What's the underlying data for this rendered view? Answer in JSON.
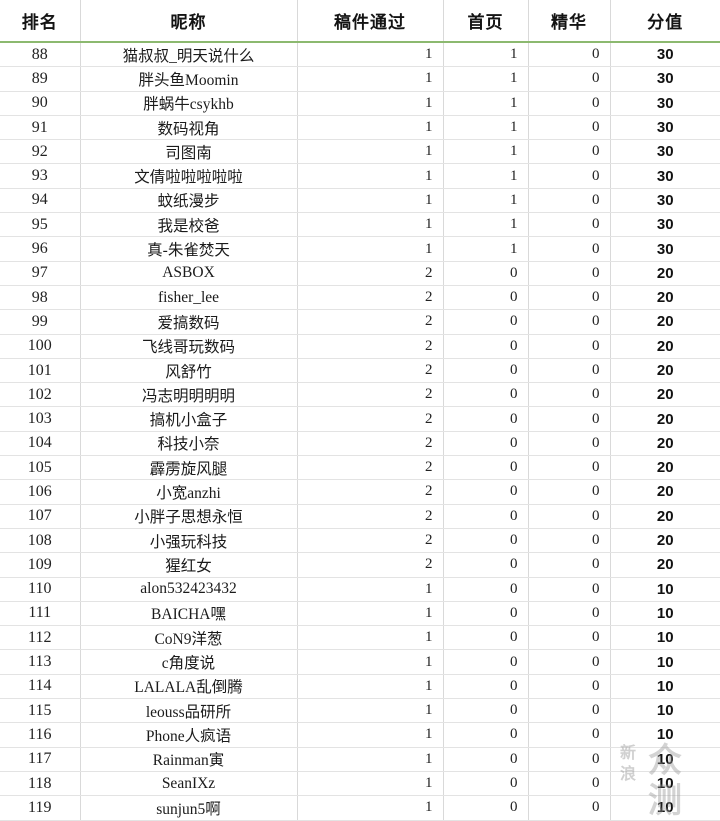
{
  "table": {
    "columns": [
      {
        "key": "rank",
        "label": "排名",
        "align": "center"
      },
      {
        "key": "nick",
        "label": "昵称",
        "align": "center"
      },
      {
        "key": "pass",
        "label": "稿件通过",
        "align": "right"
      },
      {
        "key": "home",
        "label": "首页",
        "align": "right"
      },
      {
        "key": "elite",
        "label": "精华",
        "align": "right"
      },
      {
        "key": "score",
        "label": "分值",
        "align": "center"
      }
    ],
    "rows": [
      {
        "rank": "88",
        "nick": "猫叔叔_明天说什么",
        "pass": "1",
        "home": "1",
        "elite": "0",
        "score": "30"
      },
      {
        "rank": "89",
        "nick": "胖头鱼Moomin",
        "pass": "1",
        "home": "1",
        "elite": "0",
        "score": "30"
      },
      {
        "rank": "90",
        "nick": "胖蜗牛csykhb",
        "pass": "1",
        "home": "1",
        "elite": "0",
        "score": "30"
      },
      {
        "rank": "91",
        "nick": "数码视角",
        "pass": "1",
        "home": "1",
        "elite": "0",
        "score": "30"
      },
      {
        "rank": "92",
        "nick": "司图南",
        "pass": "1",
        "home": "1",
        "elite": "0",
        "score": "30"
      },
      {
        "rank": "93",
        "nick": "文倩啦啦啦啦啦",
        "pass": "1",
        "home": "1",
        "elite": "0",
        "score": "30"
      },
      {
        "rank": "94",
        "nick": "蚊纸漫步",
        "pass": "1",
        "home": "1",
        "elite": "0",
        "score": "30"
      },
      {
        "rank": "95",
        "nick": "我是校爸",
        "pass": "1",
        "home": "1",
        "elite": "0",
        "score": "30"
      },
      {
        "rank": "96",
        "nick": "真-朱雀焚天",
        "pass": "1",
        "home": "1",
        "elite": "0",
        "score": "30"
      },
      {
        "rank": "97",
        "nick": "ASBOX",
        "pass": "2",
        "home": "0",
        "elite": "0",
        "score": "20"
      },
      {
        "rank": "98",
        "nick": "fisher_lee",
        "pass": "2",
        "home": "0",
        "elite": "0",
        "score": "20"
      },
      {
        "rank": "99",
        "nick": "爱搞数码",
        "pass": "2",
        "home": "0",
        "elite": "0",
        "score": "20"
      },
      {
        "rank": "100",
        "nick": "飞线哥玩数码",
        "pass": "2",
        "home": "0",
        "elite": "0",
        "score": "20"
      },
      {
        "rank": "101",
        "nick": "风舒竹",
        "pass": "2",
        "home": "0",
        "elite": "0",
        "score": "20"
      },
      {
        "rank": "102",
        "nick": "冯志明明明明",
        "pass": "2",
        "home": "0",
        "elite": "0",
        "score": "20"
      },
      {
        "rank": "103",
        "nick": "搞机小盒子",
        "pass": "2",
        "home": "0",
        "elite": "0",
        "score": "20"
      },
      {
        "rank": "104",
        "nick": "科技小奈",
        "pass": "2",
        "home": "0",
        "elite": "0",
        "score": "20"
      },
      {
        "rank": "105",
        "nick": "霹雳旋风腿",
        "pass": "2",
        "home": "0",
        "elite": "0",
        "score": "20"
      },
      {
        "rank": "106",
        "nick": "小宽anzhi",
        "pass": "2",
        "home": "0",
        "elite": "0",
        "score": "20"
      },
      {
        "rank": "107",
        "nick": "小胖子思想永恒",
        "pass": "2",
        "home": "0",
        "elite": "0",
        "score": "20"
      },
      {
        "rank": "108",
        "nick": "小强玩科技",
        "pass": "2",
        "home": "0",
        "elite": "0",
        "score": "20"
      },
      {
        "rank": "109",
        "nick": "猩红女",
        "pass": "2",
        "home": "0",
        "elite": "0",
        "score": "20"
      },
      {
        "rank": "110",
        "nick": "alon532423432",
        "pass": "1",
        "home": "0",
        "elite": "0",
        "score": "10"
      },
      {
        "rank": "111",
        "nick": "BAICHA嘿",
        "pass": "1",
        "home": "0",
        "elite": "0",
        "score": "10"
      },
      {
        "rank": "112",
        "nick": "CoN9洋葱",
        "pass": "1",
        "home": "0",
        "elite": "0",
        "score": "10"
      },
      {
        "rank": "113",
        "nick": "c角度说",
        "pass": "1",
        "home": "0",
        "elite": "0",
        "score": "10"
      },
      {
        "rank": "114",
        "nick": "LALALA乱倒腾",
        "pass": "1",
        "home": "0",
        "elite": "0",
        "score": "10"
      },
      {
        "rank": "115",
        "nick": "leouss品研所",
        "pass": "1",
        "home": "0",
        "elite": "0",
        "score": "10"
      },
      {
        "rank": "116",
        "nick": "Phone人疯语",
        "pass": "1",
        "home": "0",
        "elite": "0",
        "score": "10"
      },
      {
        "rank": "117",
        "nick": "Rainman寅",
        "pass": "1",
        "home": "0",
        "elite": "0",
        "score": "10"
      },
      {
        "rank": "118",
        "nick": "SeanIXz",
        "pass": "1",
        "home": "0",
        "elite": "0",
        "score": "10"
      },
      {
        "rank": "119",
        "nick": "sunjun5啊",
        "pass": "1",
        "home": "0",
        "elite": "0",
        "score": "10"
      }
    ]
  },
  "watermark": {
    "small_text": "新浪",
    "big_text": "众测"
  },
  "colors": {
    "header_underline": "#8cb96f",
    "grid_line": "#d9d9d9",
    "row_line": "#e3e3e3",
    "text": "#1b1b1b"
  }
}
